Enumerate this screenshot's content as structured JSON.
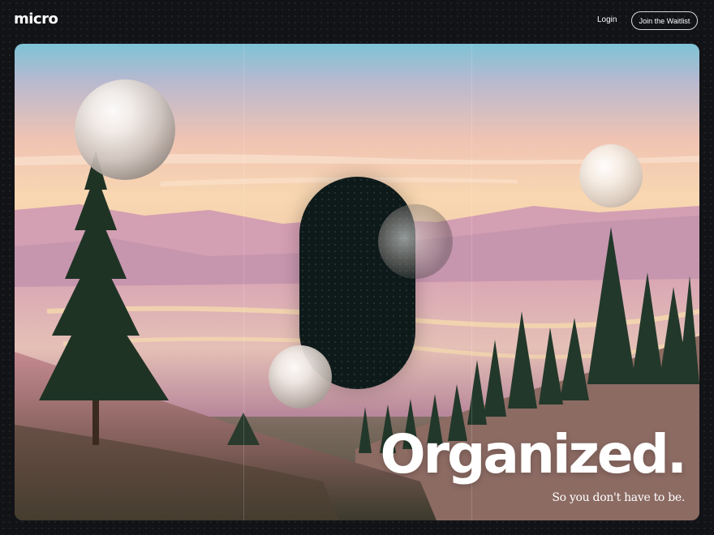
{
  "header": {
    "logo": "micro",
    "login_label": "Login",
    "cta_label": "Join the Waitlist"
  },
  "hero": {
    "headline": "Organized.",
    "tagline": "So you don't have to be."
  },
  "colors": {
    "page_background": "#121317",
    "pill": "#0e1a1a",
    "text": "#ffffff"
  }
}
